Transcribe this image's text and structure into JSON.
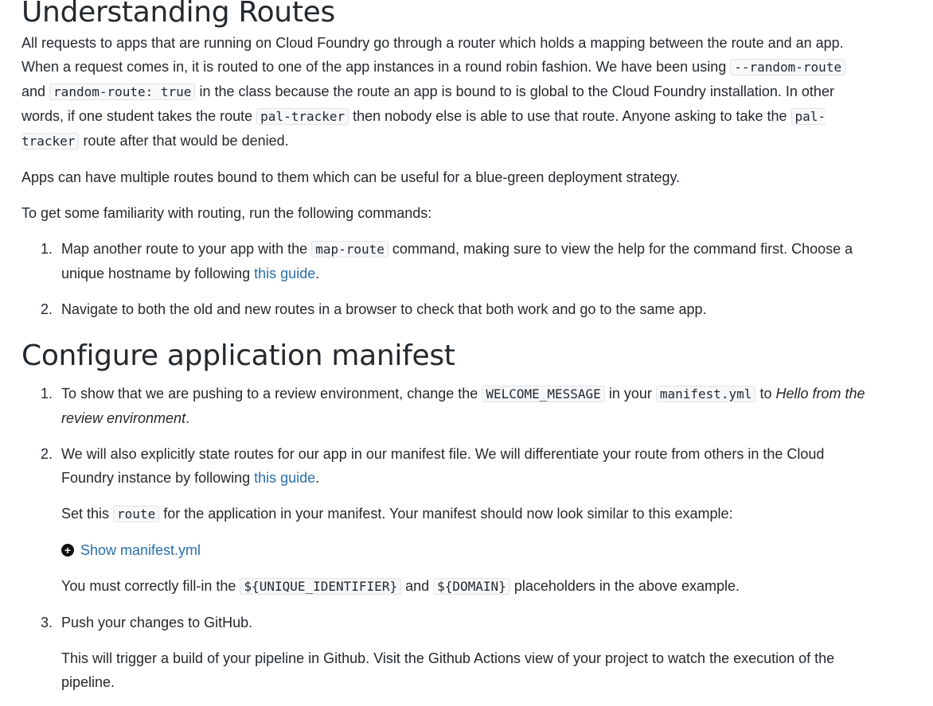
{
  "section1": {
    "heading": "Understanding Routes",
    "p1": {
      "t1": "All requests to apps that are running on Cloud Foundry go through a router which holds a mapping between the route and an app. When a request comes in, it is routed to one of the app instances in a round robin fashion. We have been using ",
      "c1": "--random-route",
      "t2": " and ",
      "c2": "random-route: true",
      "t3": " in the class because the route an app is bound to is global to the Cloud Foundry installation. In other words, if one student takes the route ",
      "c3": "pal-tracker",
      "t4": " then nobody else is able to use that route. Anyone asking to take the ",
      "c4": "pal-tracker",
      "t5": " route after that would be denied."
    },
    "p2": "Apps can have multiple routes bound to them which can be useful for a blue-green deployment strategy.",
    "p3": "To get some familiarity with routing, run the following commands:",
    "steps": [
      {
        "num": "1.",
        "t1": "Map another route to your app with the ",
        "code": "map-route",
        "t2": " command, making sure to view the help for the command first. Choose a unique hostname by following ",
        "link": "this guide",
        "t3": "."
      },
      {
        "num": "2.",
        "text": "Navigate to both the old and new routes in a browser to check that both work and go to the same app."
      }
    ]
  },
  "section2": {
    "heading": "Configure application manifest",
    "steps": [
      {
        "num": "1.",
        "t1": "To show that we are pushing to a review environment, change the ",
        "code1": "WELCOME_MESSAGE",
        "t2": " in your ",
        "code2": "manifest.yml",
        "t3": " to ",
        "em": "Hello from the review environment",
        "t4": "."
      },
      {
        "num": "2.",
        "t1": "We will also explicitly state routes for our app in our manifest file. We will differentiate your route from others in the Cloud Foundry instance by following ",
        "link": "this guide",
        "t2": ".",
        "sub1": {
          "t1": "Set this ",
          "code": "route",
          "t2": " for the application in your manifest. Your manifest should now look similar to this example:"
        },
        "toggle_label": "Show manifest.yml",
        "toggle_icon": "plus-circle-icon",
        "sub2": {
          "t1": "You must correctly fill-in the ",
          "code1": "${UNIQUE_IDENTIFIER}",
          "t2": " and ",
          "code2": "${DOMAIN}",
          "t3": " placeholders in the above example."
        }
      },
      {
        "num": "3.",
        "text": "Push your changes to GitHub.",
        "sub": "This will trigger a build of your pipeline in Github. Visit the Github Actions view of your project to watch the execution of the pipeline."
      }
    ]
  },
  "colors": {
    "text": "#24292e",
    "link": "#2a6fa8",
    "code_bg": "#f6f8fa",
    "code_border": "#e1e4e8"
  }
}
